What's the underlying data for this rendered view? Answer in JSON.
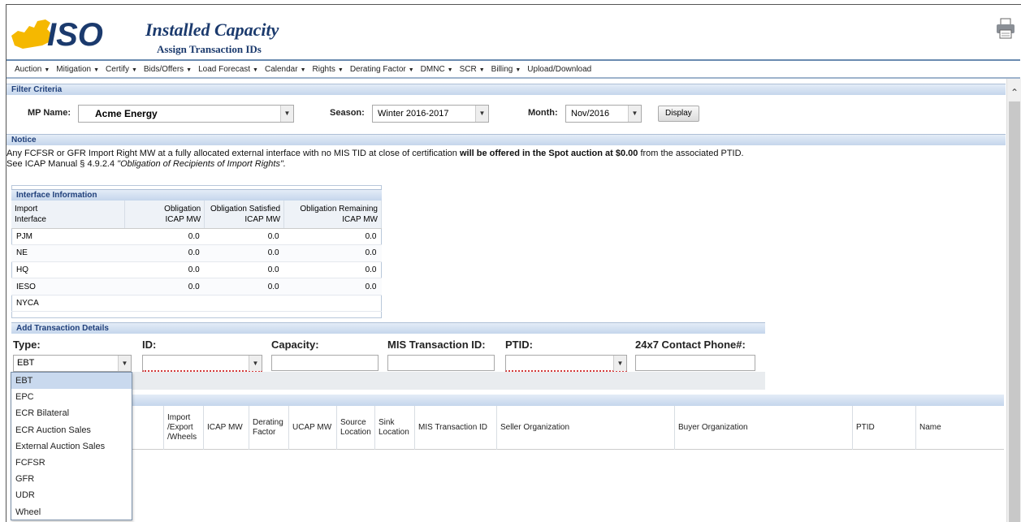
{
  "header": {
    "logo_text": "ISO",
    "title": "Installed Capacity",
    "subtitle": "Assign Transaction IDs",
    "print_icon": "printer-icon"
  },
  "menu": [
    {
      "label": "Auction",
      "has_caret": true
    },
    {
      "label": "Mitigation",
      "has_caret": true
    },
    {
      "label": "Certify",
      "has_caret": true
    },
    {
      "label": "Bids/Offers",
      "has_caret": true
    },
    {
      "label": "Load Forecast",
      "has_caret": true
    },
    {
      "label": "Calendar",
      "has_caret": true
    },
    {
      "label": "Rights",
      "has_caret": true
    },
    {
      "label": "Derating Factor",
      "has_caret": true
    },
    {
      "label": "DMNC",
      "has_caret": true
    },
    {
      "label": "SCR",
      "has_caret": true
    },
    {
      "label": "Billing",
      "has_caret": true
    },
    {
      "label": "Upload/Download",
      "has_caret": false
    }
  ],
  "filter": {
    "section_title": "Filter Criteria",
    "mp_label": "MP Name:",
    "mp_value": "Acme Energy",
    "season_label": "Season:",
    "season_value": "Winter 2016-2017",
    "month_label": "Month:",
    "month_value": "Nov/2016",
    "display_button": "Display"
  },
  "notice": {
    "section_title": "Notice",
    "line1_a": "Any FCFSR or GFR Import Right MW at a fully allocated external interface with no MIS TID at close of certification ",
    "line1_b": "will be offered in the Spot auction at $0.00",
    "line1_c": " from the associated PTID.",
    "line2_a": "See ICAP Manual § 4.9.2.4 ",
    "line2_b": "\"Obligation of Recipients of Import Rights\"."
  },
  "interface": {
    "section_title": "Interface Information",
    "headers": [
      "Import\nInterface",
      "Obligation\nICAP MW",
      "Obligation Satisfied\nICAP MW",
      "Obligation Remaining\nICAP MW"
    ],
    "rows": [
      [
        "PJM",
        "0.0",
        "0.0",
        "0.0"
      ],
      [
        "NE",
        "0.0",
        "0.0",
        "0.0"
      ],
      [
        "HQ",
        "0.0",
        "0.0",
        "0.0"
      ],
      [
        "IESO",
        "0.0",
        "0.0",
        "0.0"
      ],
      [
        "NYCA",
        "",
        "",
        ""
      ]
    ]
  },
  "add_transaction": {
    "section_title": "Add Transaction Details",
    "type_label": "Type:",
    "type_value": "EBT",
    "id_label": "ID:",
    "capacity_label": "Capacity:",
    "mis_label": "MIS Transaction ID:",
    "ptid_label": "PTID:",
    "phone_label": "24x7 Contact Phone#:",
    "type_options": [
      "EBT",
      "EPC",
      "ECR Bilateral",
      "ECR Auction Sales",
      "External Auction Sales",
      "FCFSR",
      "GFR",
      "UDR",
      "Wheel"
    ]
  },
  "results": {
    "columns": [
      "Import\n/Export\n/Wheels",
      "ICAP MW",
      "Derating\nFactor",
      "UCAP MW",
      "Source\nLocation",
      "Sink\nLocation",
      "MIS Transaction ID",
      "Seller Organization",
      "Buyer Organization",
      "PTID",
      "Name"
    ]
  }
}
